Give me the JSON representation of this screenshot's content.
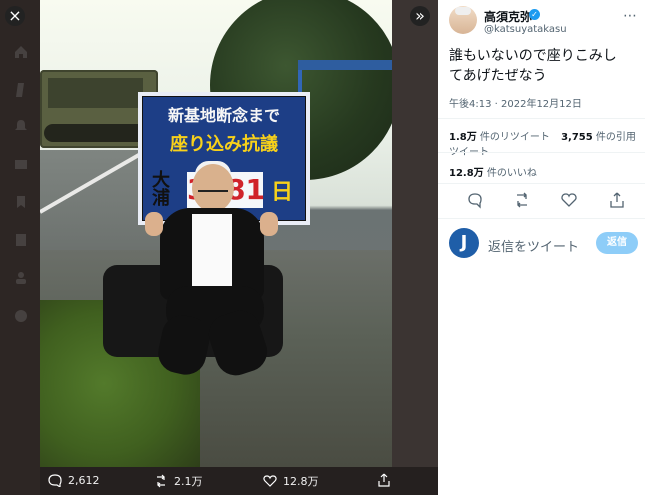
{
  "viewer": {
    "close_label": "×",
    "expand_label": "»"
  },
  "photo": {
    "sign": {
      "line1": "新基地断念まで",
      "line2": "座り込み抗議",
      "side_text": "大浦",
      "count": "3381",
      "day_label": "日"
    },
    "bottom_bar": {
      "reply_count": "2,612",
      "retweet_count": "2.1万",
      "like_count": "12.8万"
    }
  },
  "tweet": {
    "display_name": "高須克弥",
    "handle": "@katsuyatakasu",
    "text": "誰もいないので座りこみし\nてあげたぜなう",
    "timestamp": "午後4:13 · 2022年12月12日",
    "stats": {
      "retweets_value": "1.8万",
      "retweets_label": "件のリツイート",
      "quotes_value": "3,755",
      "quotes_label": "件の引用ツイート",
      "likes_value": "12.8万",
      "likes_label": "件のいいね"
    },
    "reply": {
      "avatar_letter": "J",
      "placeholder": "返信をツイート",
      "button_label": "返信"
    }
  },
  "icons": {
    "rail": [
      "home-icon",
      "explore-icon",
      "notifications-icon",
      "messages-icon",
      "bookmarks-icon",
      "lists-icon",
      "profile-icon",
      "more-icon"
    ],
    "accent": "#1d9bf0"
  }
}
